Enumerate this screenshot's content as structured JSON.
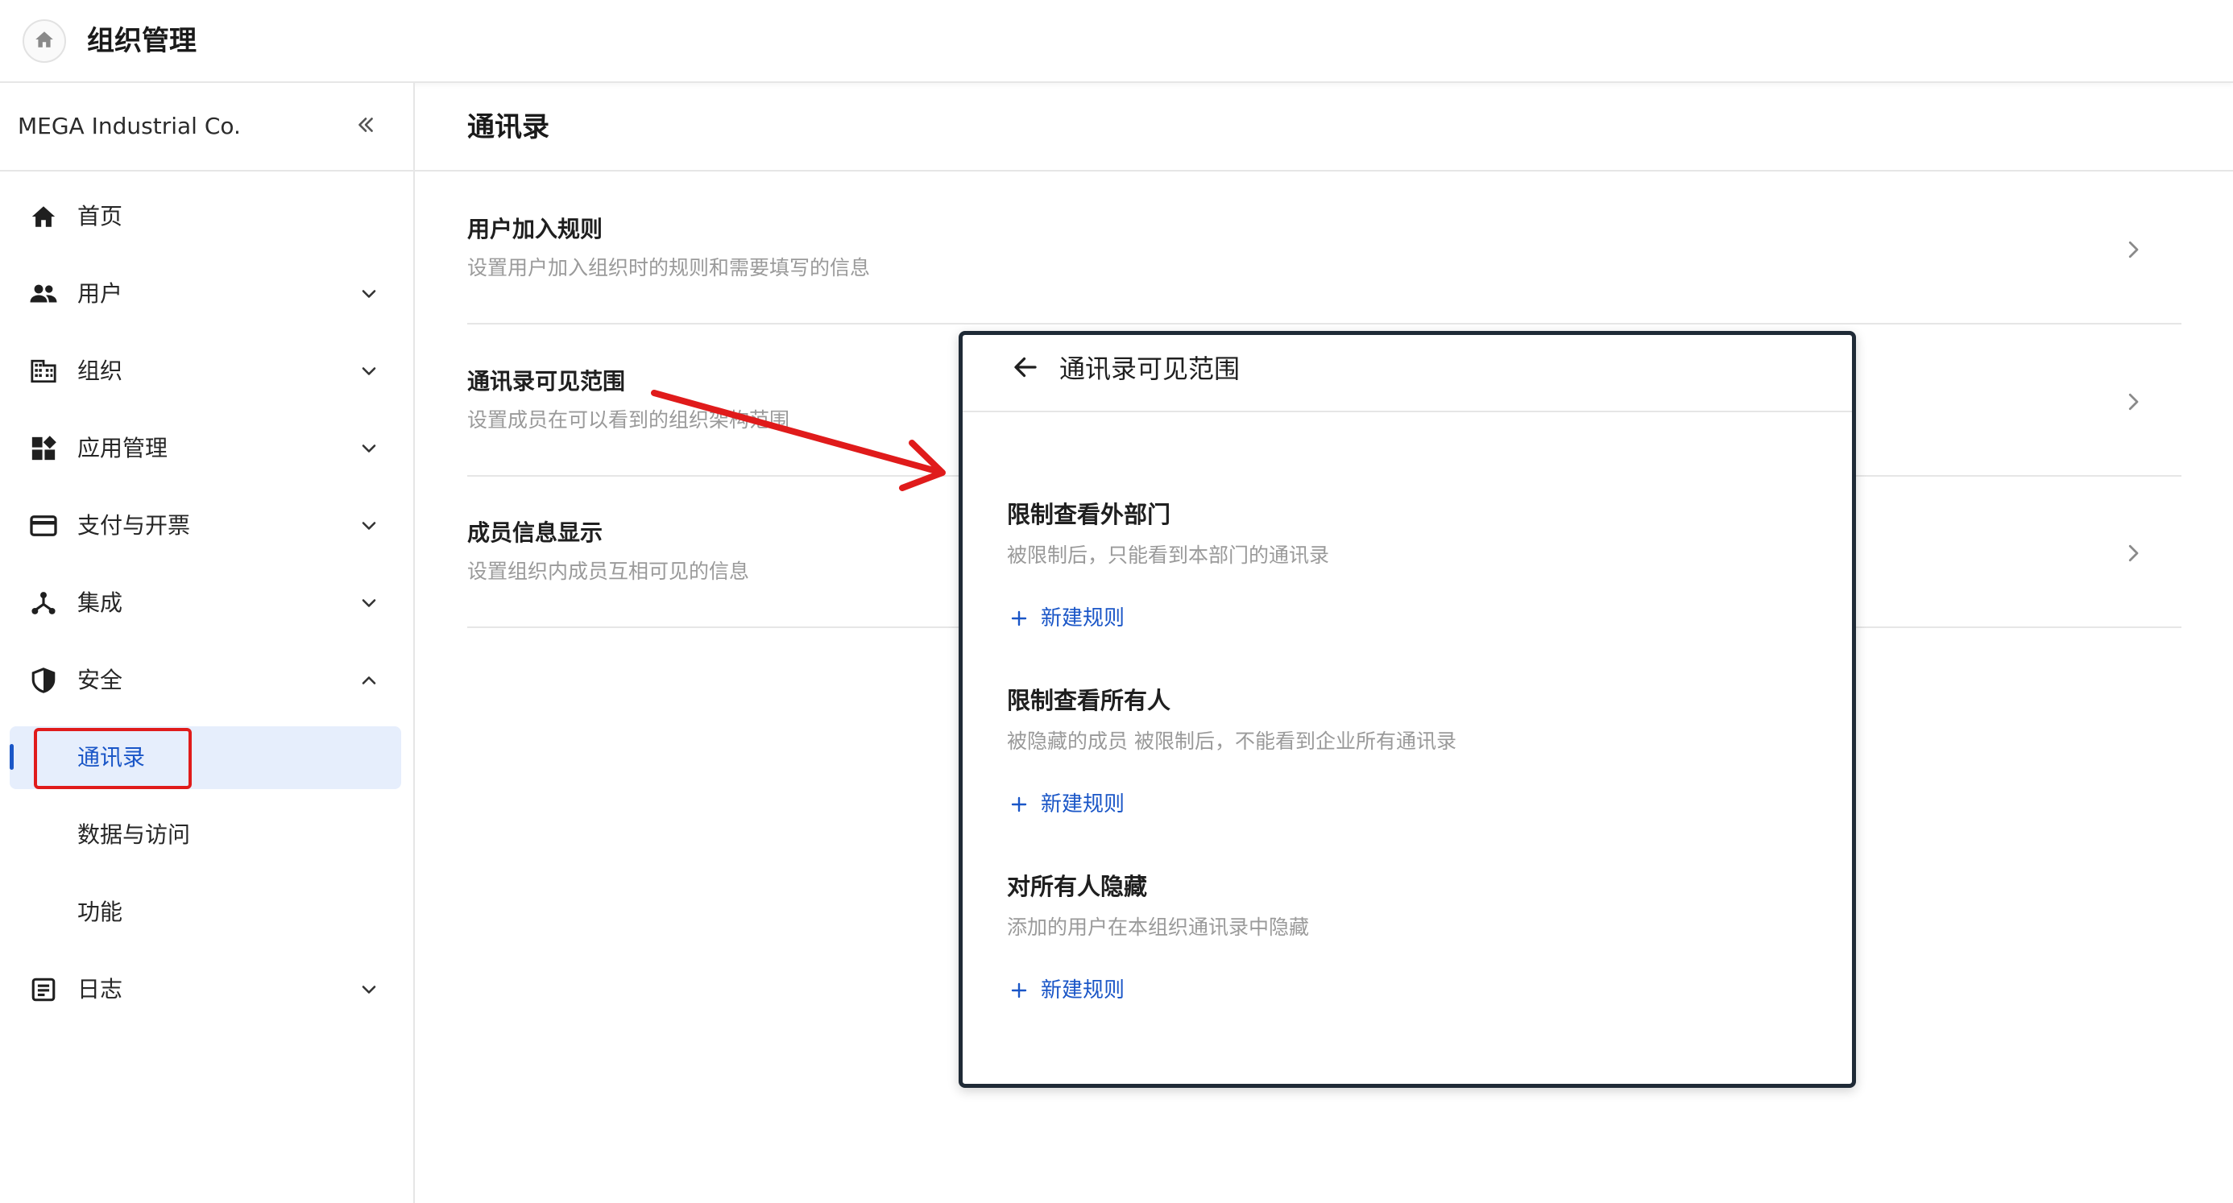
{
  "header": {
    "title": "组织管理",
    "home_icon": "home-icon"
  },
  "sidebar": {
    "org_name": "MEGA Industrial Co.",
    "collapse_icon": "double-chevron-left-icon",
    "items": [
      {
        "label": "首页",
        "icon": "home-icon",
        "expandable": false
      },
      {
        "label": "用户",
        "icon": "users-icon",
        "expandable": true,
        "expanded": false
      },
      {
        "label": "组织",
        "icon": "building-icon",
        "expandable": true,
        "expanded": false
      },
      {
        "label": "应用管理",
        "icon": "apps-icon",
        "expandable": true,
        "expanded": false
      },
      {
        "label": "支付与开票",
        "icon": "credit-card-icon",
        "expandable": true,
        "expanded": false
      },
      {
        "label": "集成",
        "icon": "integration-icon",
        "expandable": true,
        "expanded": false
      },
      {
        "label": "安全",
        "icon": "shield-icon",
        "expandable": true,
        "expanded": true
      },
      {
        "label": "日志",
        "icon": "log-icon",
        "expandable": true,
        "expanded": false
      }
    ],
    "security_sub": [
      {
        "label": "通讯录",
        "active": true
      },
      {
        "label": "数据与访问",
        "active": false
      },
      {
        "label": "功能",
        "active": false
      }
    ]
  },
  "main": {
    "title": "通讯录",
    "settings": [
      {
        "title": "用户加入规则",
        "desc": "设置用户加入组织时的规则和需要填写的信息"
      },
      {
        "title": "通讯录可见范围",
        "desc": "设置成员在可以看到的组织架构范围"
      },
      {
        "title": "成员信息显示",
        "desc": "设置组织内成员互相可见的信息"
      }
    ]
  },
  "overlay": {
    "title": "通讯录可见范围",
    "back_icon": "arrow-left-icon",
    "rules": [
      {
        "title": "限制查看外部门",
        "desc": "被限制后，只能看到本部门的通讯录",
        "add_label": "新建规则"
      },
      {
        "title": "限制查看所有人",
        "desc": "被隐藏的成员 被限制后，不能看到企业所有通讯录",
        "add_label": "新建规则"
      },
      {
        "title": "对所有人隐藏",
        "desc": "添加的用户在本组织通讯录中隐藏",
        "add_label": "新建规则"
      }
    ]
  },
  "colors": {
    "accent": "#1a56c7",
    "active_bg": "#e6eefc",
    "annotation_red": "#e01b1b",
    "overlay_border": "#1f2a36"
  }
}
